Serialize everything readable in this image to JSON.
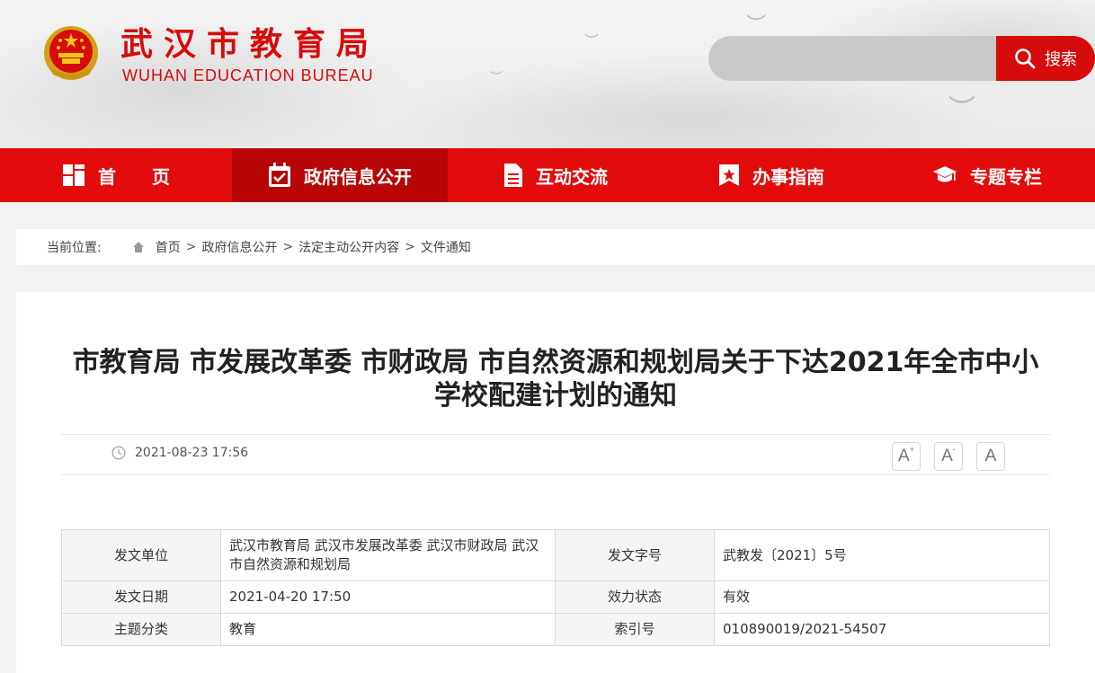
{
  "header": {
    "title": "武汉市教育局",
    "subtitle": "WUHAN EDUCATION BUREAU",
    "search": {
      "placeholder": "",
      "button_label": "搜索"
    }
  },
  "nav": [
    {
      "label": "首　　页",
      "icon": "home-grid-icon",
      "active": false
    },
    {
      "label": "政府信息公开",
      "icon": "calendar-check-icon",
      "active": true
    },
    {
      "label": "互动交流",
      "icon": "document-icon",
      "active": false
    },
    {
      "label": "办事指南",
      "icon": "bookmark-star-icon",
      "active": false
    },
    {
      "label": "专题专栏",
      "icon": "graduation-cap-icon",
      "active": false
    }
  ],
  "breadcrumb": {
    "label": "当前位置:",
    "items": [
      "首页",
      "政府信息公开",
      "法定主动公开内容",
      "文件通知"
    ],
    "separator": ">"
  },
  "article": {
    "title": "市教育局 市发展改革委 市财政局 市自然资源和规划局关于下达2021年全市中小学校配建计划的通知",
    "date": "2021-08-23 17:56",
    "font_buttons": [
      "A+",
      "A-",
      "A"
    ]
  },
  "info_table": {
    "rows": [
      {
        "k1": "发文单位",
        "v1": "武汉市教育局 武汉市发展改革委 武汉市财政局 武汉市自然资源和规划局",
        "k2": "发文字号",
        "v2": "武教发〔2021〕5号"
      },
      {
        "k1": "发文日期",
        "v1": "2021-04-20 17:50",
        "k2": "效力状态",
        "v2": "有效"
      },
      {
        "k1": "主题分类",
        "v1": "教育",
        "k2": "索引号",
        "v2": "010890019/2021-54507"
      }
    ]
  },
  "colors": {
    "brand_red": "#e20c0c",
    "active_red": "#b80606",
    "title_red": "#d70b0b"
  }
}
